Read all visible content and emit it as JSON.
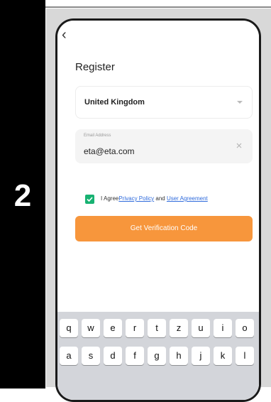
{
  "step": {
    "number": "2"
  },
  "screen": {
    "title": "Register",
    "back_glyph": "‹",
    "country": {
      "value": "United Kingdom",
      "icon": "chevron-down-icon"
    },
    "email": {
      "label": "Email Address",
      "value": "eta@eta.com",
      "clear_icon": "close-icon"
    },
    "agreement": {
      "checked": true,
      "prefix": "I Agree",
      "privacy_link": "Privacy Policy",
      "and": " and ",
      "user_link": "User Agreement"
    },
    "verify_button": "Get Verification Code"
  },
  "keyboard": {
    "row1": [
      "q",
      "w",
      "e",
      "r",
      "t",
      "z",
      "u",
      "i",
      "o"
    ],
    "row2": [
      "a",
      "s",
      "d",
      "f",
      "g",
      "h",
      "j",
      "k",
      "l"
    ]
  },
  "colors": {
    "accent_orange": "#f7963c",
    "checkbox_green": "#18b272",
    "link_blue": "#2f6bdc"
  }
}
